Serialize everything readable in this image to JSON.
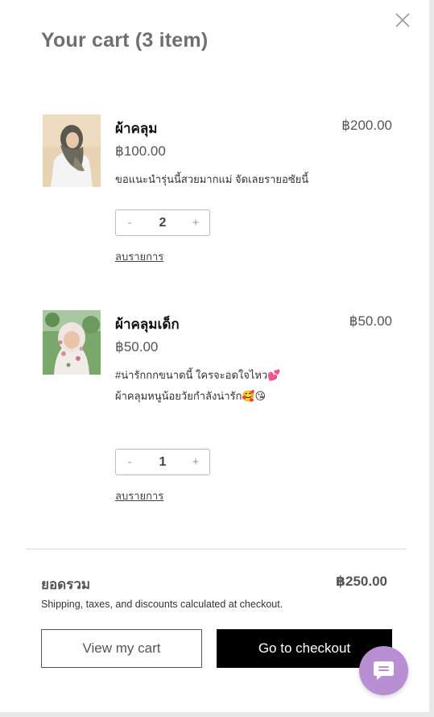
{
  "drawer": {
    "title": "Your cart (3 item)"
  },
  "items": [
    {
      "name": "ผ้าคลุม",
      "line_total": "฿200.00",
      "unit_price": "฿100.00",
      "note_lines": [
        "ขอแนะนำรุ่นนี้สวยมากแม่ จัดเลยรายอซัยนี้"
      ],
      "quantity": "2",
      "minus_label": "-",
      "plus_label": "+",
      "remove_label": "ลบรายการ"
    },
    {
      "name": "ผ้าคลุมเด็ก",
      "line_total": "฿50.00",
      "unit_price": "฿50.00",
      "note_lines": [
        "#น่ารักกกขนาดนี้ ใครจะอดใจไหว💕",
        "ผ้าคลุมหนูน้อยวัยกำลังน่ารัก🥰😘"
      ],
      "quantity": "1",
      "minus_label": "-",
      "plus_label": "+",
      "remove_label": "ลบรายการ"
    }
  ],
  "summary": {
    "subtotal_label": "ยอดรวม",
    "subtotal_value": "฿250.00",
    "shipping_note": "Shipping, taxes, and discounts calculated at checkout."
  },
  "buttons": {
    "view_cart": "View my cart",
    "checkout": "Go to checkout"
  },
  "icons": {
    "close": "close-icon",
    "chat": "chat-bubble-icon"
  },
  "colors": {
    "checkout_bg": "#000000",
    "chat_bg": "#b88fd3",
    "title": "#6f6f6f"
  }
}
